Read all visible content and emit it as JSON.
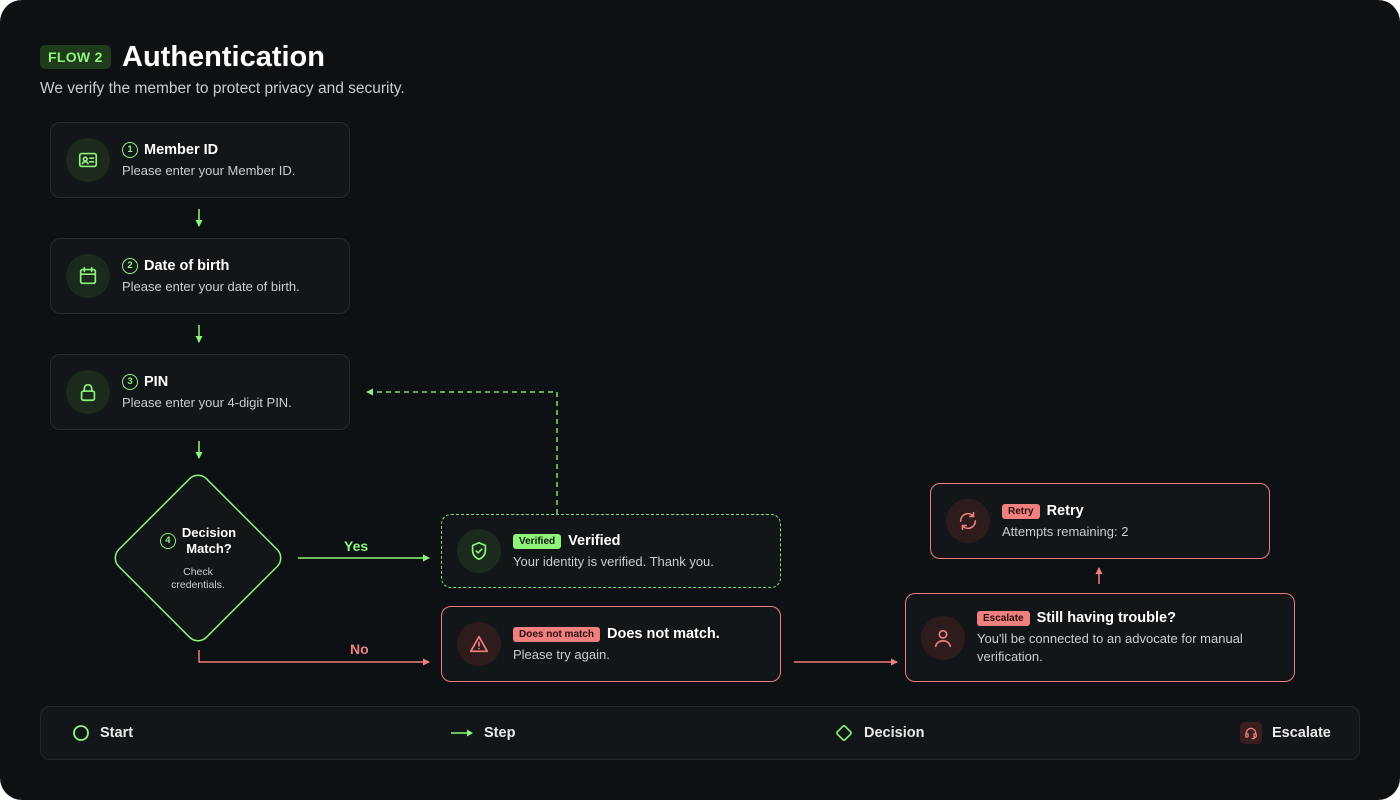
{
  "header": {
    "badge": "FLOW 2",
    "title": "Authentication",
    "subtitle": "We verify the member to protect privacy and security."
  },
  "steps": [
    {
      "number": "1",
      "title": "Member ID",
      "description": "Please enter your Member ID.",
      "icon": "id-card-icon"
    },
    {
      "number": "2",
      "title": "Date of birth",
      "description": "Please enter your date of birth.",
      "icon": "calendar-icon"
    },
    {
      "number": "3",
      "title": "PIN",
      "description": "Please enter your 4-digit PIN.",
      "icon": "lock-icon"
    }
  ],
  "decision": {
    "number": "4",
    "title_line1": "Decision",
    "title_line2": "Match?",
    "desc_line1": "Check",
    "desc_line2": "credentials."
  },
  "branches": {
    "yes_label": "Yes",
    "no_label": "No"
  },
  "verified": {
    "tag": "Verified",
    "title": "Verified",
    "description": "Your identity is verified. Thank you.",
    "icon": "shield-check-icon"
  },
  "mismatch": {
    "tag": "Does not match",
    "title": "Does not match.",
    "description": "Please try again.",
    "icon": "warning-icon"
  },
  "escalate": {
    "tag": "Escalate",
    "title": "Still having trouble?",
    "description_line1": "You'll be connected to an advocate for manual",
    "description_line2": "verification.",
    "icon": "person-icon"
  },
  "retry": {
    "tag": "Retry",
    "title": "Retry",
    "description": "Attempts remaining: 2",
    "icon": "refresh-icon"
  },
  "legend": {
    "start": "Start",
    "step": "Step",
    "decision": "Decision",
    "escalate": "Escalate"
  },
  "colors": {
    "background": "#0d1114",
    "accent_green": "#8ef57a",
    "accent_red": "#f07f7f",
    "card": "#121619",
    "text": "#ffffff",
    "muted_text": "#c9cdd1"
  }
}
